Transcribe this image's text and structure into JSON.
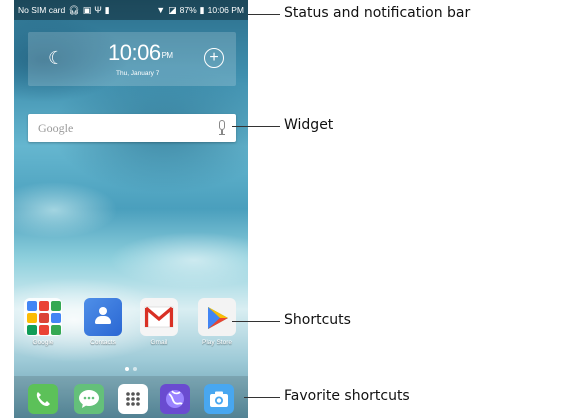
{
  "status_bar": {
    "carrier": "No SIM card",
    "battery": "87%",
    "time": "10:06 PM"
  },
  "clock_widget": {
    "time": "10:06",
    "ampm": "PM",
    "date": "Thu, January 7"
  },
  "search_widget": {
    "placeholder": "Google"
  },
  "shortcuts": [
    {
      "label": "Google"
    },
    {
      "label": "Contacts"
    },
    {
      "label": "Gmail"
    },
    {
      "label": "Play Store"
    }
  ],
  "dock": [
    "phone-icon",
    "messaging-icon",
    "all-apps-icon",
    "browser-icon",
    "camera-icon"
  ],
  "callouts": {
    "status": "Status and notification bar",
    "widget": "Widget",
    "shortcuts": "Shortcuts",
    "favorites": "Favorite shortcuts"
  },
  "colors": {
    "accent": "#48a7f0",
    "phone": "#5cc159",
    "browser": "#6a4bd0"
  }
}
